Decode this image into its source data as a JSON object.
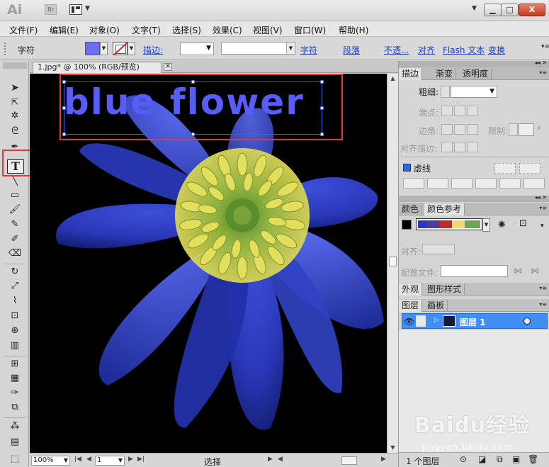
{
  "app": {
    "logo": "Ai",
    "bridge_badge": "Br",
    "layout_icon": "layout-grid-icon"
  },
  "window": {
    "minimize": "▁",
    "maximize": "□",
    "close": "X"
  },
  "menu": [
    "文件(F)",
    "编辑(E)",
    "对象(O)",
    "文字(T)",
    "选择(S)",
    "效果(C)",
    "视图(V)",
    "窗口(W)",
    "帮助(H)"
  ],
  "control": {
    "label": "字符",
    "fill_color": "#6d6dfa",
    "stroke_link": "描边:",
    "character_link": "字符",
    "paragraph_link": "段落",
    "opacity_link": "不透...",
    "align_link": "对齐",
    "flash_text_link": "Flash 文本",
    "transform_link": "变换"
  },
  "document": {
    "tab_title": "1.jpg* @ 100% (RGB/预览)",
    "close": "✕",
    "artwork_text": "blue flower",
    "artwork_color": "#5a5cf7"
  },
  "status": {
    "zoom": "100%",
    "page": "1",
    "mode": "选择"
  },
  "stroke_panel": {
    "tabs": [
      "描边",
      "渐变",
      "透明度"
    ],
    "weight_label": "粗细:",
    "cap_label": "端点:",
    "corner_label": "边角:",
    "limit_label": "限制:",
    "limit_x": "x",
    "align_label": "对齐描边:",
    "dashed_label": "虚线"
  },
  "color_panel": {
    "tabs": [
      "颜色",
      "颜色参考"
    ],
    "swatches": [
      "#2a36c8",
      "#4a3aa8",
      "#c62828",
      "#f3d96b",
      "#6aa85a"
    ],
    "align_label": "对齐:",
    "profile_label": "配置文件:"
  },
  "appearance_panel": {
    "tabs": [
      "外观",
      "图形样式"
    ]
  },
  "layers_panel": {
    "tabs": [
      "图层",
      "画板"
    ],
    "layer_name": "图层 1",
    "footer_count": "1 个图层"
  },
  "watermark": {
    "brand": "Baidu经验",
    "url": "jingyan.baidu.com"
  }
}
